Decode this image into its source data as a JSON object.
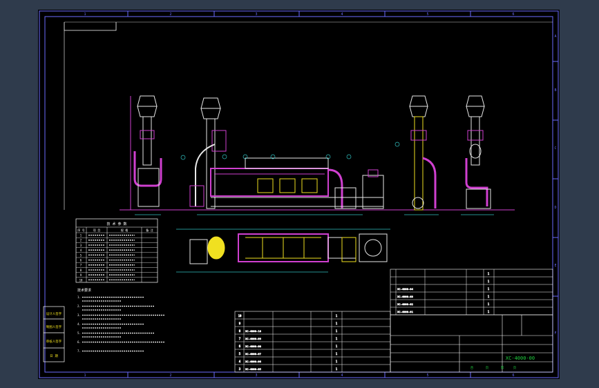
{
  "drawing": {
    "border_labels_top": [
      "1",
      "2",
      "3",
      "4",
      "5",
      "6"
    ],
    "border_labels_side": [
      "A",
      "B",
      "C",
      "D",
      "E",
      "F"
    ],
    "drawing_number": "XC-4000-00",
    "title_block": {
      "left_rows": [
        "设计人签字",
        "制图人签字",
        "审核人签字",
        "日 期"
      ],
      "bottom_row": [
        "合",
        "页",
        "第",
        "页"
      ]
    },
    "tech_table": {
      "title": "技 术 参 数",
      "headers": [
        "序 号",
        "项 目",
        "规 格",
        "备 注"
      ],
      "row_numbers": [
        "1",
        "2",
        "3",
        "4",
        "5",
        "6",
        "7",
        "8",
        "9",
        "10"
      ]
    },
    "notes_title": "技术要求",
    "notes_numbers": [
      "1.",
      "2.",
      "3.",
      "4.",
      "5.",
      "6.",
      "7."
    ],
    "bom_upper": {
      "codes": [
        "XC-4000-04",
        "XC-4000-03",
        "XC-4000-02",
        "XC-4000-01"
      ],
      "qty": [
        "1",
        "1",
        "1",
        "1",
        "1",
        "1"
      ]
    },
    "bom_lower": {
      "items": [
        "10",
        "9",
        "8",
        "7",
        "6",
        "5",
        "4",
        "3"
      ],
      "codes": [
        "XC-4000-10",
        "XC-4000-09",
        "XC-4000-08",
        "XC-4000-07",
        "XC-4000-06",
        "XC-4000-05"
      ],
      "qty": [
        "1",
        "1",
        "1",
        "1",
        "1",
        "1",
        "1",
        "1"
      ]
    }
  },
  "colors": {
    "frame": "#6b6bff",
    "pipe": "#d040d0",
    "structure": "#e8e8e8",
    "dims": "#30c0c0",
    "accent": "#f0e020",
    "table": "#ffffff",
    "green_text": "#20d040"
  }
}
